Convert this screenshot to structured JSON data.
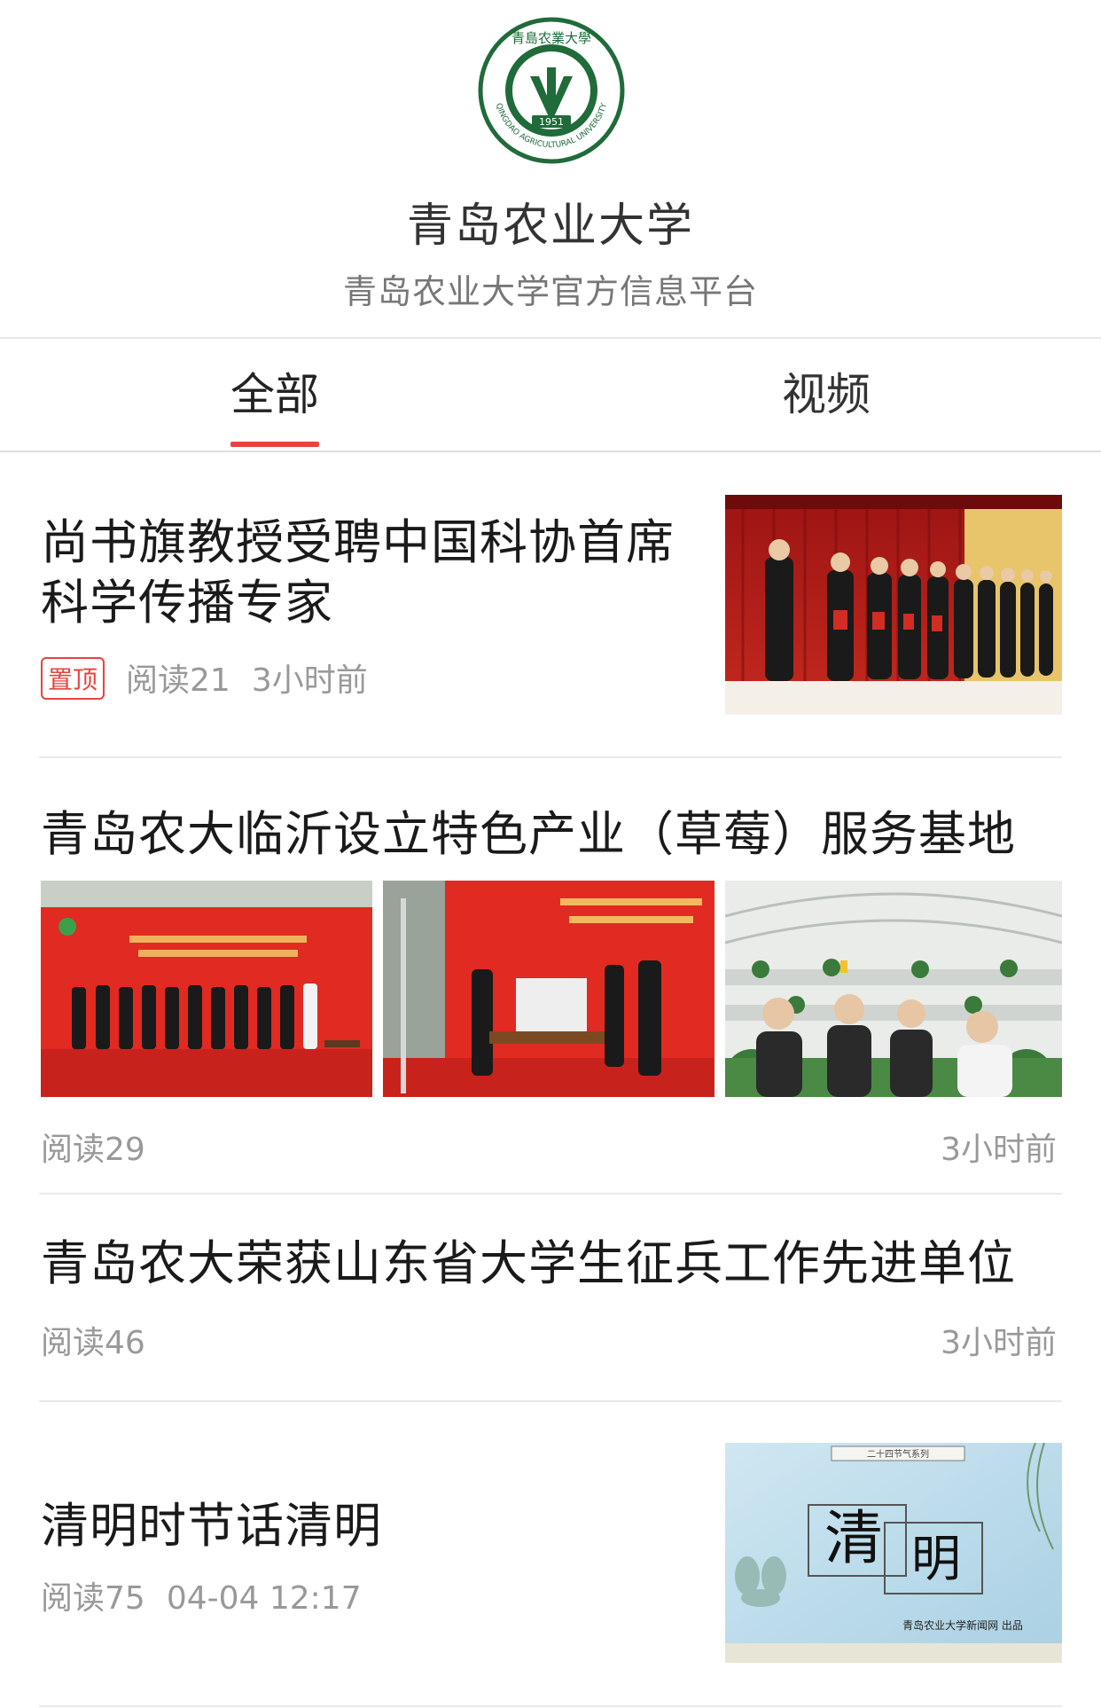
{
  "header": {
    "app_title": "青岛农业大学",
    "app_subtitle": "青岛农业大学官方信息平台",
    "logo": {
      "top_text": "青島农業大學",
      "year": "1951",
      "bottom_text": "QINGDAO AGRICULTURAL UNIVERSITY",
      "color": "#1f6b3a"
    }
  },
  "tabs": [
    {
      "label": "全部",
      "active": true
    },
    {
      "label": "视频",
      "active": false
    }
  ],
  "accent_color": "#e64340",
  "articles": [
    {
      "title_line1": "尚书旗教授受聘中国科协首席",
      "title_line2": "科学传播专家",
      "pin_label": "置顶",
      "reads": "阅读21",
      "time": "3小时前"
    },
    {
      "title": "青岛农大临沂设立特色产业（草莓）服务基地",
      "reads": "阅读29",
      "time": "3小时前"
    },
    {
      "title": "青岛农大荣获山东省大学生征兵工作先进单位",
      "reads": "阅读46",
      "time": "3小时前"
    },
    {
      "title": "清明时节话清明",
      "reads": "阅读75",
      "time": "04-04 12:17",
      "thumb_text_1": "清",
      "thumb_text_2": "明",
      "thumb_caption": "青岛农业大学新闻网 出品",
      "thumb_banner": "二十四节气系列"
    }
  ]
}
